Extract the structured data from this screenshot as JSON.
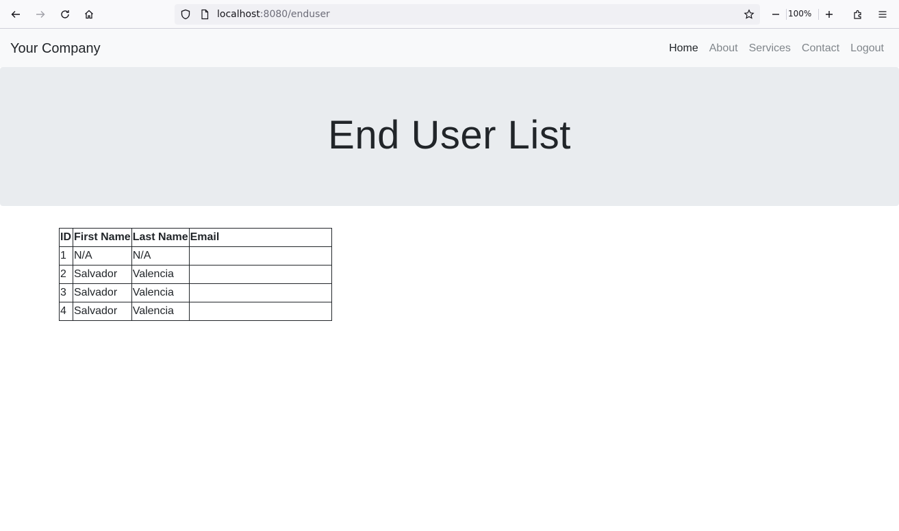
{
  "browser": {
    "url_host": "localhost",
    "url_path": ":8080/enduser",
    "zoom": "100%",
    "icons": [
      "back-arrow-icon",
      "forward-arrow-icon",
      "reload-icon",
      "home-icon",
      "shield-icon",
      "page-icon",
      "star-icon",
      "zoom-out-icon",
      "zoom-in-icon",
      "extensions-icon",
      "menu-icon"
    ]
  },
  "navbar": {
    "brand": "Your Company",
    "links": [
      {
        "label": "Home",
        "active": true
      },
      {
        "label": "About",
        "active": false
      },
      {
        "label": "Services",
        "active": false
      },
      {
        "label": "Contact",
        "active": false
      },
      {
        "label": "Logout",
        "active": false
      }
    ]
  },
  "header": {
    "title": "End User List"
  },
  "table": {
    "columns": [
      "ID",
      "First Name",
      "Last Name",
      "Email"
    ],
    "rows": [
      [
        "1",
        "N/A",
        "N/A",
        ""
      ],
      [
        "2",
        "Salvador",
        "Valencia",
        ""
      ],
      [
        "3",
        "Salvador",
        "Valencia",
        ""
      ],
      [
        "4",
        "Salvador",
        "Valencia",
        ""
      ]
    ]
  },
  "colors": {
    "navbar_bg": "#f8f9fa",
    "jumbotron_bg": "#e9ecef",
    "text": "#212529",
    "nav_inactive": "#80868b"
  }
}
